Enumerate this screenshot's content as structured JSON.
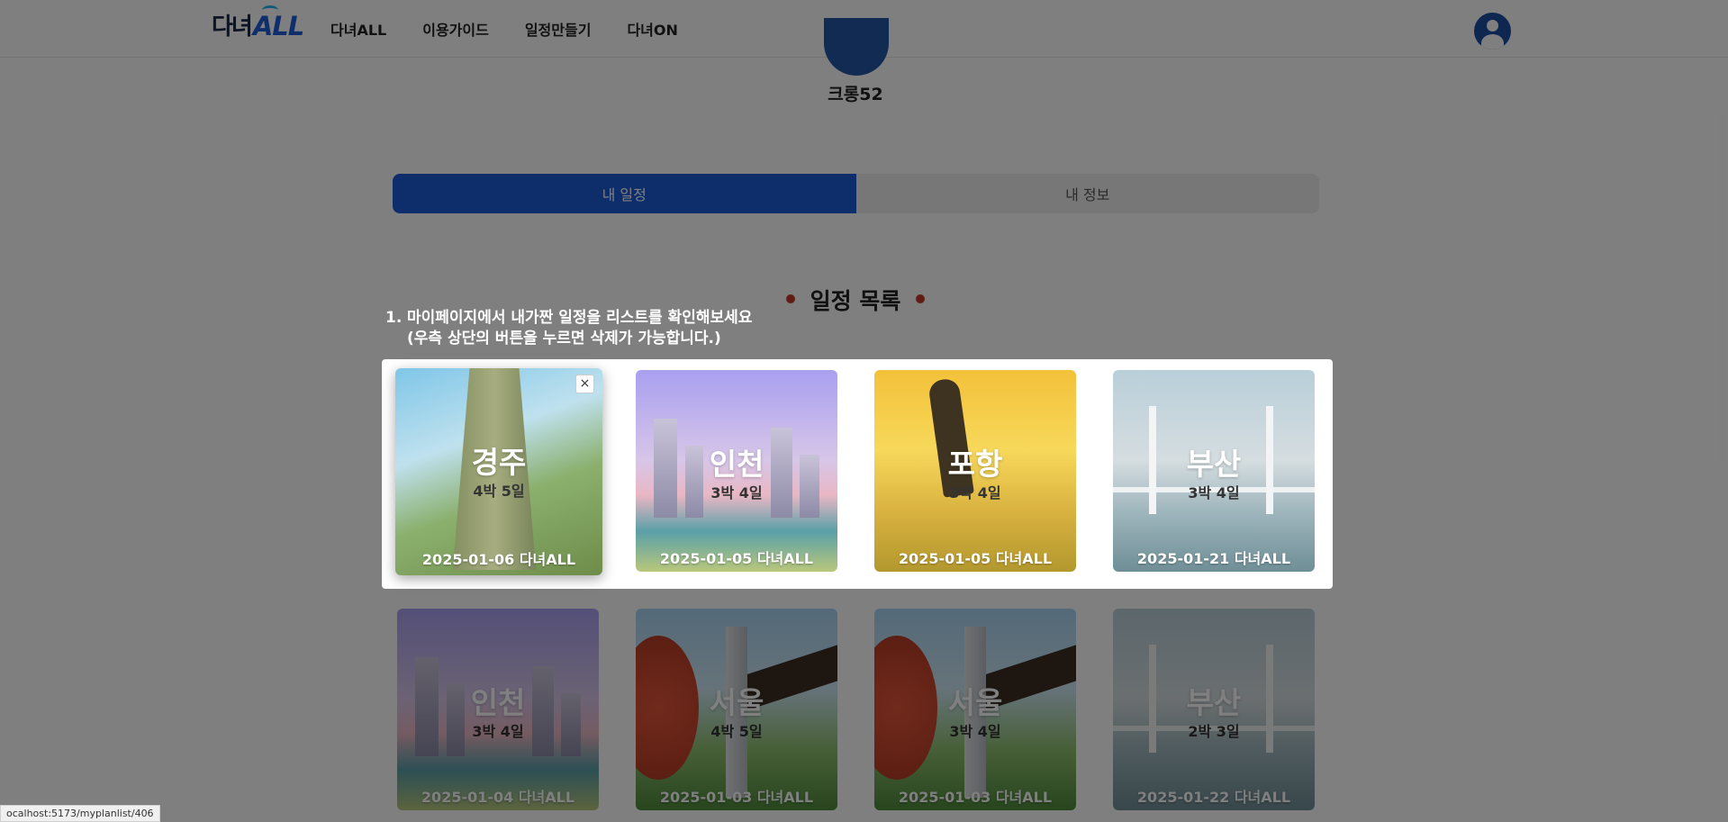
{
  "header": {
    "logo_part1": "다녀",
    "logo_part2": "ALL",
    "nav": [
      "다녀ALL",
      "이용가이드",
      "일정만들기",
      "다녀ON"
    ]
  },
  "profile": {
    "username": "크롱52"
  },
  "tabs": [
    {
      "label": "내 일정",
      "active": true
    },
    {
      "label": "내 정보",
      "active": false
    }
  ],
  "section_title": "일정 목록",
  "guide": {
    "number": "1.",
    "line1": "마이페이지에서 내가짠 일정을 리스트를 확인해보세요",
    "line2": "(우측 상단의 버튼을 누르면 삭제가 가능합니다.)"
  },
  "plans": [
    {
      "city": "경주",
      "nights": "4박 5일",
      "footer": "2025-01-06 다녀ALL",
      "delete": "×"
    },
    {
      "city": "인천",
      "nights": "3박 4일",
      "footer": "2025-01-05 다녀ALL"
    },
    {
      "city": "포항",
      "nights": "3박 4일",
      "footer": "2025-01-05 다녀ALL"
    },
    {
      "city": "부산",
      "nights": "3박 4일",
      "footer": "2025-01-21 다녀ALL"
    },
    {
      "city": "인천",
      "nights": "3박 4일",
      "footer": "2025-01-04 다녀ALL"
    },
    {
      "city": "서울",
      "nights": "4박 5일",
      "footer": "2025-01-03 다녀ALL"
    },
    {
      "city": "서울",
      "nights": "3박 4일",
      "footer": "2025-01-03 다녀ALL"
    },
    {
      "city": "부산",
      "nights": "2박 3일",
      "footer": "2025-01-22 다녀ALL"
    }
  ],
  "statusbar": "ocalhost:5173/myplanlist/406",
  "colors": {
    "primary": "#1b5bd6",
    "accent_dot": "#c0392b",
    "tab_inactive": "#eeeeee"
  }
}
